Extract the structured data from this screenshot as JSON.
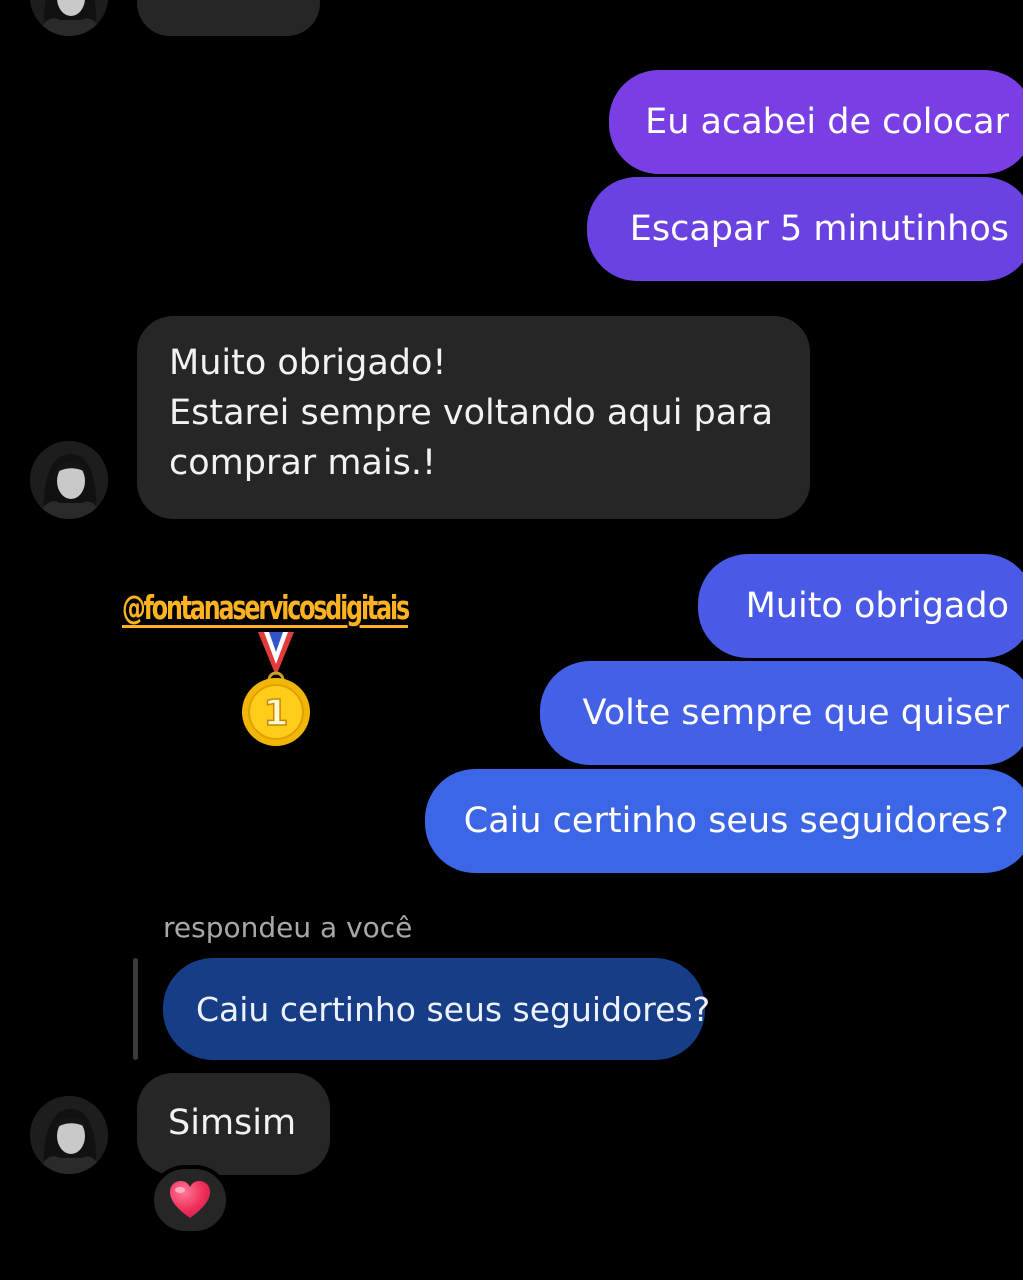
{
  "conversation": {
    "messages": [
      {
        "sender": "me",
        "text": "Eu acabei de colocar"
      },
      {
        "sender": "me",
        "text": "Escapar 5 minutinhos"
      },
      {
        "sender": "contact",
        "lines": [
          "Muito obrigado!",
          "Estarei sempre voltando aqui para",
          "comprar mais.!"
        ]
      },
      {
        "sender": "me",
        "text": "Muito obrigado"
      },
      {
        "sender": "me",
        "text": "Volte sempre que quiser"
      },
      {
        "sender": "me",
        "text": "Caiu certinho seus seguidores?"
      },
      {
        "sender": "contact",
        "reply_label": "respondeu a você",
        "quoted_text": "Caiu certinho seus seguidores?",
        "text": "Simsim",
        "reaction": "heart-emoji"
      }
    ]
  },
  "overlay": {
    "watermark_handle": "@fontanaservicosdigitais",
    "medal_number": "1",
    "watermark_icon": "gold-medal-icon"
  },
  "colors": {
    "background": "#000000",
    "incoming_bubble": "#262626",
    "outgoing_purple": "#6e3ee0",
    "outgoing_blue": "#3f63e6",
    "quoted_bubble": "#163d86",
    "watermark": "#ffb320"
  }
}
